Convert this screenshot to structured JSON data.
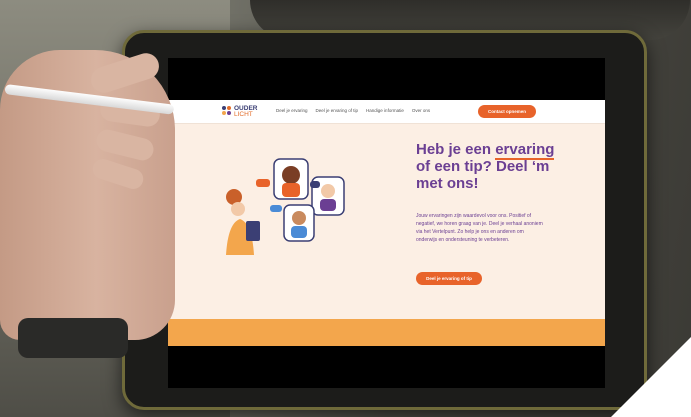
{
  "site": {
    "logo": {
      "line1": "OUDER",
      "line2": "LICHT"
    },
    "nav": [
      "Deel je ervaring",
      "Deel je ervaring of tip",
      "Handige informatie",
      "Over ons"
    ],
    "cta": "Contact opnemen",
    "hero": {
      "title_prefix": "Heb je een ",
      "title_highlight": "ervaring",
      "title_suffix": " of een tip? Deel ‘m met ons!",
      "body": "Jouw ervaringen zijn waardevol voor ons. Positief of negatief, we horen graag van je. Deel je verhaal anoniem via het Vertelpunt. Zo help je ons en anderen om onderwijs en ondersteuning te verbeteren.",
      "button": "Deel je ervaring of tip"
    }
  },
  "colors": {
    "purple": "#6b3f93",
    "orange": "#e8632a",
    "band": "#f3a64c",
    "background": "#fcefe4"
  }
}
